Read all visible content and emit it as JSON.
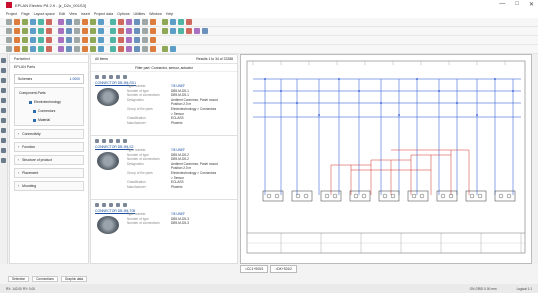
{
  "window": {
    "title": "EPLAN Electric P8 2.9 - [z_D2x_001S3]",
    "controls": [
      "—",
      "□",
      "✕"
    ]
  },
  "menu": [
    "Project",
    "Page",
    "Layout space",
    "Edit",
    "View",
    "Insert",
    "Project data",
    "Options",
    "Utilities",
    "Window",
    "Help"
  ],
  "nav": {
    "title": "Partselect",
    "tab_label": "EPLAN Parts",
    "filter_label": "Schemes",
    "filter_value": "1.0000",
    "tree": [
      "Component-Parts",
      "Electrotechnology",
      "Connectors",
      "Material"
    ],
    "groups": [
      "Connectivity",
      "Function",
      "Structure of product",
      "Placement",
      "Mounting"
    ]
  },
  "parts_panel": {
    "header_left": "All Items",
    "header_right": "Results 1 to 34 of 22288",
    "sub_header": "Filter part: Connector, sensor, actuator",
    "cards": [
      {
        "link": "CONNECTOR DB-9M-SD1",
        "rows": [
          {
            "k": "Type number",
            "v": "7/8 UNEF"
          },
          {
            "k": "Number of type",
            "v": "DB9-M-D5-1"
          },
          {
            "k": "Number of connections",
            "v": "DB9-M-D5-1"
          },
          {
            "k": "Designation",
            "v": "Ambient Connector, Panel mount"
          },
          {
            "k": "",
            "v": "Position 2.0 m"
          },
          {
            "k": "Group of the parts",
            "v": "Electrotechnology > Connectors"
          },
          {
            "k": "",
            "v": "> Sensor"
          },
          {
            "k": "Classification",
            "v": "ECLASS"
          },
          {
            "k": "Manufacturer",
            "v": "Phoenix"
          }
        ]
      },
      {
        "link": "CONNECTOR DB-9M-S2",
        "rows": [
          {
            "k": "Type number",
            "v": "7/8 UNEF"
          },
          {
            "k": "Number of type",
            "v": "DB9-M-D5-2"
          },
          {
            "k": "Number of connections",
            "v": "DB9-M-D5-2"
          },
          {
            "k": "Designation",
            "v": "Ambient Connector, Panel mount"
          },
          {
            "k": "",
            "v": "Position 2.0 m"
          },
          {
            "k": "Group of the parts",
            "v": "Electrotechnology > Connectors"
          },
          {
            "k": "",
            "v": "> Sensor"
          },
          {
            "k": "Classification",
            "v": "ECLASS"
          },
          {
            "k": "Manufacturer",
            "v": "Phoenix"
          }
        ]
      },
      {
        "link": "CONNECTOR DB-9M-T08",
        "rows": [
          {
            "k": "Type number",
            "v": "7/8 UNEF"
          },
          {
            "k": "Number of type",
            "v": "DB9-M-D5-3"
          },
          {
            "k": "Number of connections",
            "v": "DB9-M-D5-3"
          }
        ]
      }
    ]
  },
  "canvas_tabs": [
    "=CC1+S00/1",
    "=DK+S01/2"
  ],
  "bottom_tabs": [
    "Selection",
    "Connections",
    "Graphic data"
  ],
  "status": {
    "left": "RX: 142.00  RY: 0.00",
    "mid": "ON  GRID  0.00 mm",
    "right": "Logical 1:1"
  },
  "colors": {
    "accent": "#c8102e",
    "link": "#1a4fa0",
    "wire_blue": "#1f4fd1",
    "wire_red": "#d0302a"
  }
}
